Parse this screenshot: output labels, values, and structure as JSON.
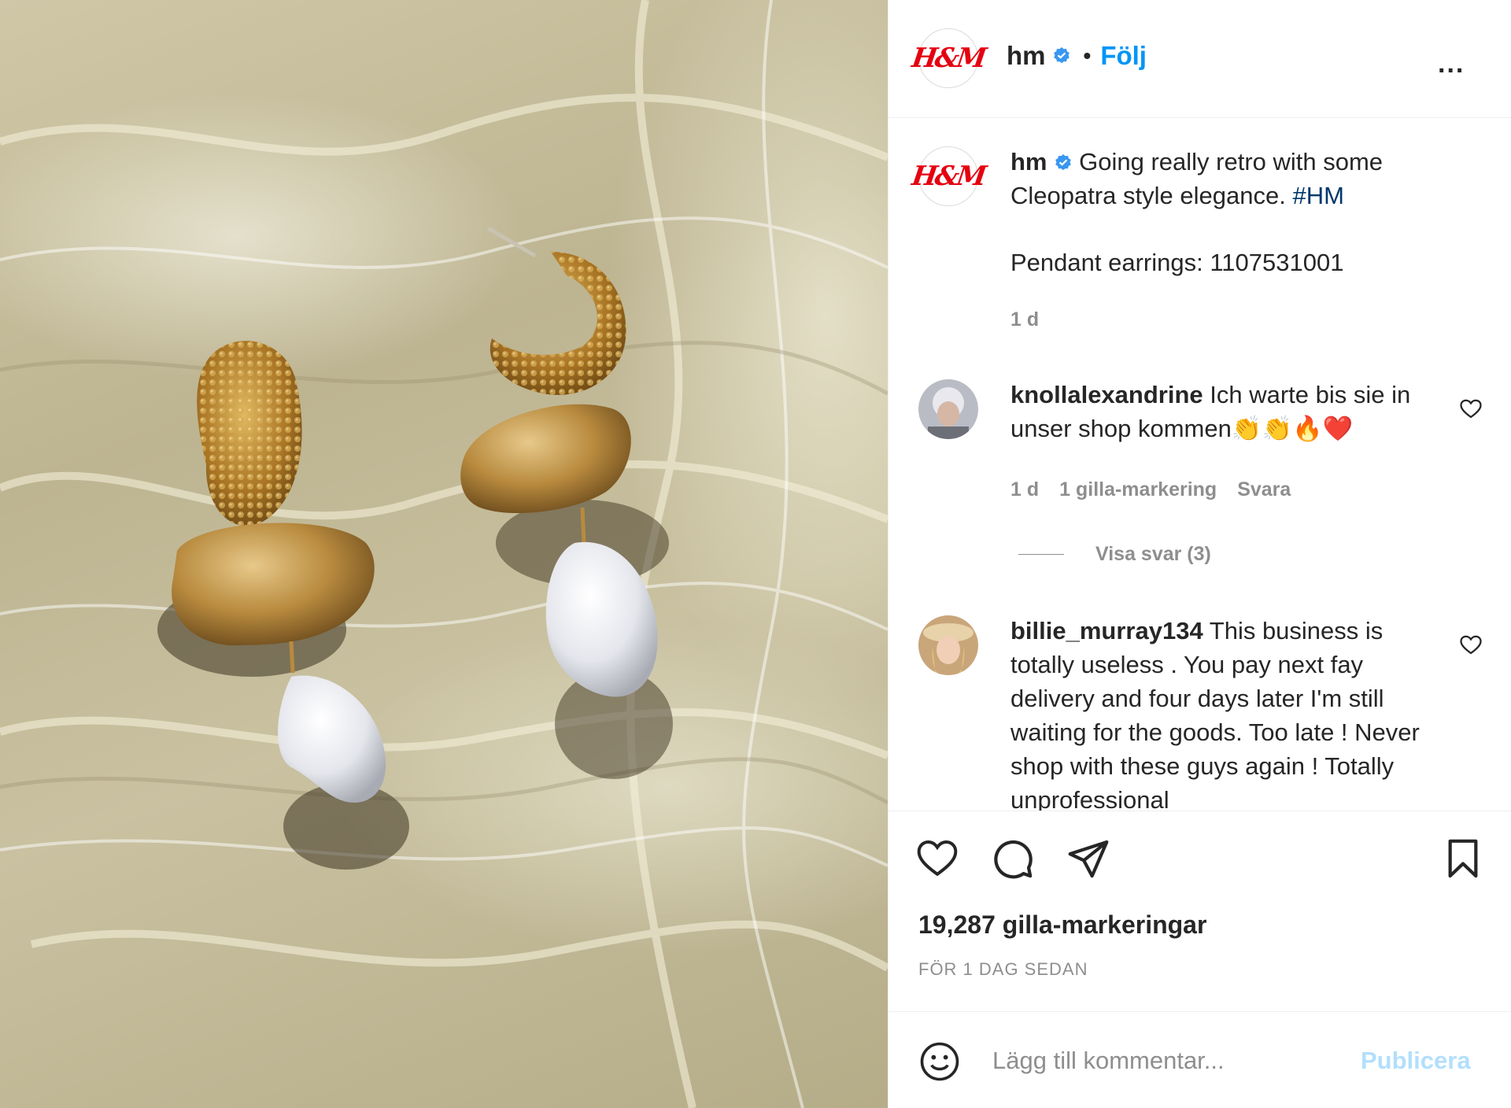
{
  "post": {
    "username": "hm",
    "follow_label": "Följ",
    "logo_text": "H&M",
    "more_label": "...",
    "caption_text": "Going really retro with some Cleopatra style elegance.",
    "hashtag": "#HM",
    "caption_line2": "Pendant earrings: 1107531001",
    "caption_time": "1 d"
  },
  "comments": [
    {
      "username": "knollalexandrine",
      "text": "Ich warte bis sie in unser shop kommen👏👏🔥❤️",
      "time": "1 d",
      "likes": "1 gilla-markering",
      "reply_label": "Svara",
      "view_replies": "Visa svar (3)"
    },
    {
      "username": "billie_murray134",
      "text": "This business is totally useless . You pay next fay delivery and four days later I'm still waiting for the goods. Too late ! Never shop with these guys again ! Totally unprofessional"
    }
  ],
  "actions": {
    "likes_count": "19,287 gilla-markeringar",
    "time_ago": "FÖR 1 DAG SEDAN"
  },
  "add_comment": {
    "placeholder": "Lägg till kommentar...",
    "publish_label": "Publicera"
  },
  "colors": {
    "link_blue": "#0095f6",
    "hashtag": "#00376b",
    "brand_red": "#e50010",
    "publish_disabled": "#b2dffc",
    "muted": "#8e8e8e"
  }
}
